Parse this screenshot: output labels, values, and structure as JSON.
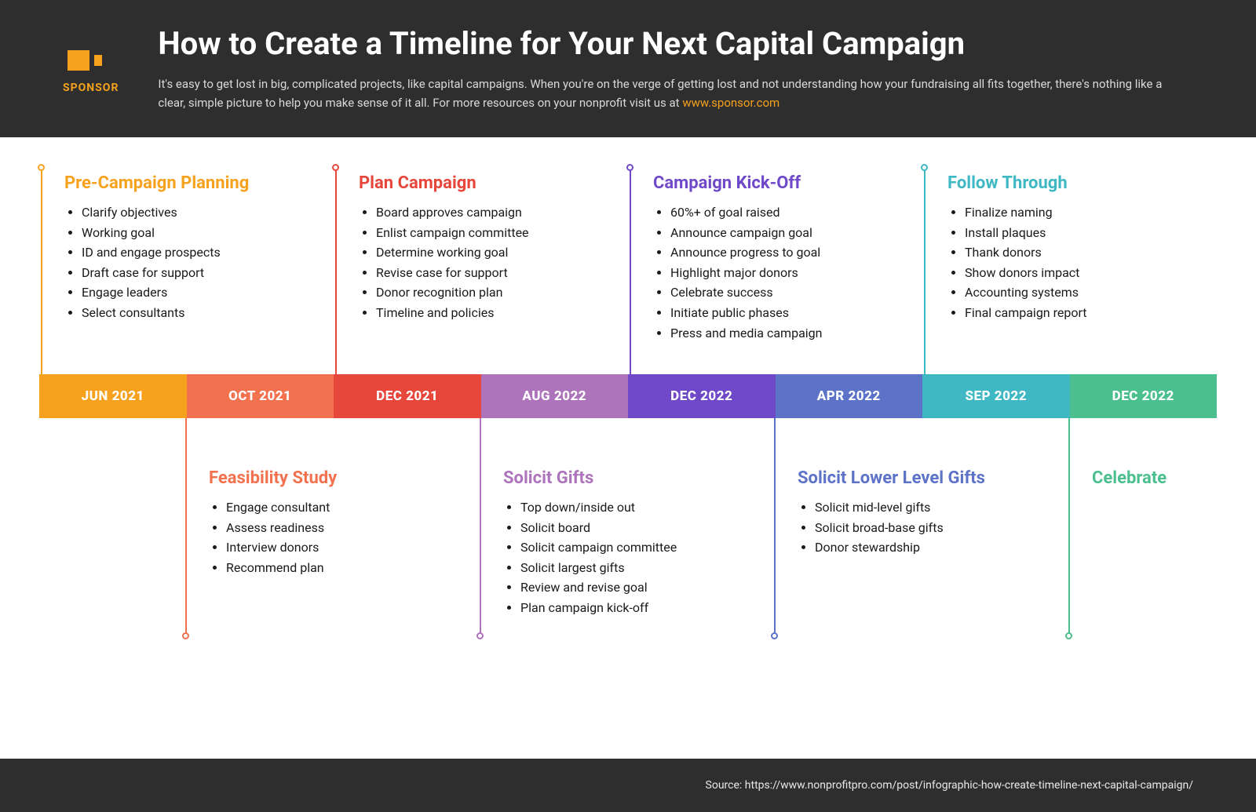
{
  "header": {
    "logo_text": "SPONSOR",
    "title": "How to Create a Timeline for Your Next Capital Campaign",
    "subtitle_1": "It's easy to get lost in big, complicated projects, like capital campaigns. When you're on the verge of getting lost and not understanding how your fundraising all fits together, there's nothing like a clear, simple picture to help you make sense of it all. For more resources on your nonprofit visit us at ",
    "subtitle_link": "www.sponsor.com"
  },
  "months": [
    {
      "label": "JUN 2021",
      "color": "#f6a21e"
    },
    {
      "label": "OCT 2021",
      "color": "#f2714f"
    },
    {
      "label": "DEC 2021",
      "color": "#e7463b"
    },
    {
      "label": "AUG 2022",
      "color": "#ad73bb"
    },
    {
      "label": "DEC 2022",
      "color": "#6f49c8"
    },
    {
      "label": "APR 2022",
      "color": "#5d73c7"
    },
    {
      "label": "SEP 2022",
      "color": "#3fb8c3"
    },
    {
      "label": "DEC 2022",
      "color": "#4bbf8e"
    }
  ],
  "phases": {
    "pre_campaign": {
      "title": "Pre-Campaign Planning",
      "color": "#f6a21e",
      "items": [
        "Clarify objectives",
        "Working goal",
        "ID and engage prospects",
        "Draft case for support",
        "Engage leaders",
        "Select consultants"
      ]
    },
    "feasibility": {
      "title": "Feasibility Study",
      "color": "#f2714f",
      "items": [
        "Engage consultant",
        "Assess readiness",
        "Interview donors",
        "Recommend plan"
      ]
    },
    "plan_campaign": {
      "title": "Plan Campaign",
      "color": "#e7463b",
      "items": [
        "Board approves campaign",
        "Enlist campaign committee",
        "Determine working goal",
        "Revise case for support",
        "Donor recognition plan",
        "Timeline and policies"
      ]
    },
    "solicit_gifts": {
      "title": "Solicit Gifts",
      "color": "#ad73bb",
      "items": [
        "Top down/inside out",
        "Solicit board",
        "Solicit campaign committee",
        "Solicit largest gifts",
        "Review and revise goal",
        "Plan campaign kick-off"
      ]
    },
    "kickoff": {
      "title": "Campaign Kick-Off",
      "color": "#6f49c8",
      "items": [
        "60%+ of goal raised",
        "Announce campaign goal",
        "Announce progress to goal",
        "Highlight major donors",
        "Celebrate success",
        "Initiate public phases",
        "Press and media campaign"
      ]
    },
    "lower_level": {
      "title": "Solicit Lower Level Gifts",
      "color": "#5d73c7",
      "items": [
        "Solicit mid-level gifts",
        "Solicit broad-base gifts",
        "Donor stewardship"
      ]
    },
    "follow_through": {
      "title": "Follow Through",
      "color": "#3fb8c3",
      "items": [
        "Finalize naming",
        "Install plaques",
        "Thank donors",
        "Show donors impact",
        "Accounting systems",
        "Final campaign report"
      ]
    },
    "celebrate": {
      "title": "Celebrate",
      "color": "#4bbf8e",
      "items": []
    }
  },
  "footer": {
    "source": "Source: https://www.nonprofitpro.com/post/infographic-how-create-timeline-next-capital-campaign/"
  }
}
